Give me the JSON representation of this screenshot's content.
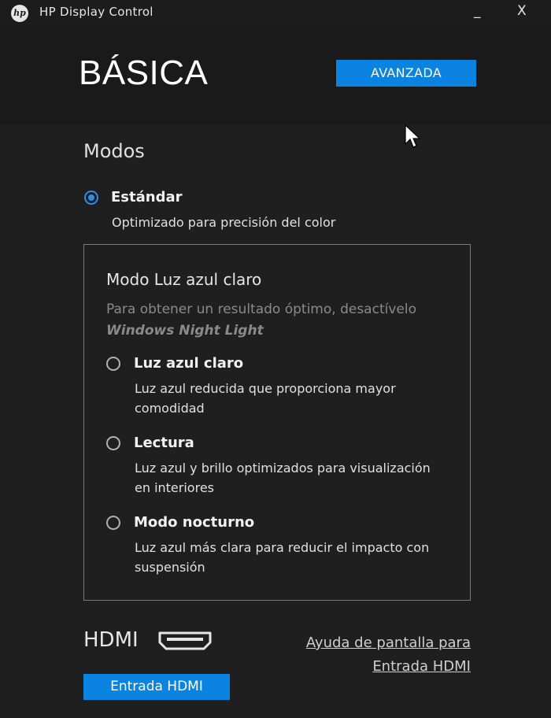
{
  "window": {
    "app_title": "HP Display Control",
    "logo_text": "hp",
    "minimize_label": "_",
    "close_label": "X"
  },
  "header": {
    "title": "BÁSICA",
    "advanced_tab_label": "AVANZADA"
  },
  "modes": {
    "section_title": "Modos",
    "standard": {
      "label": "Estándar",
      "description": "Optimizado para precisión del color",
      "selected": true
    },
    "blue_light": {
      "title": "Modo Luz azul claro",
      "note": "Para obtener un resultado óptimo, desactívelo",
      "note_emphasis": "Windows Night Light",
      "options": [
        {
          "label": "Luz azul claro",
          "description_line1": "Luz azul reducida que proporciona mayor",
          "description_line2": "comodidad",
          "selected": false
        },
        {
          "label": "Lectura",
          "description_line1": "Luz azul y brillo optimizados para visualización",
          "description_line2": "en interiores",
          "selected": false
        },
        {
          "label": "Modo nocturno",
          "description_line1": "Luz azul más clara para reducir el impacto con",
          "description_line2": "suspensión",
          "selected": false
        }
      ]
    }
  },
  "hdmi": {
    "label": "HDMI",
    "help_link_line1": "Ayuda de pantalla para",
    "help_link_line2": "Entrada HDMI",
    "input_button_label": "Entrada HDMI"
  },
  "colors": {
    "accent": "#0a84e0",
    "radio_selected": "#2b8fe8",
    "background": "#1f1f1f"
  }
}
